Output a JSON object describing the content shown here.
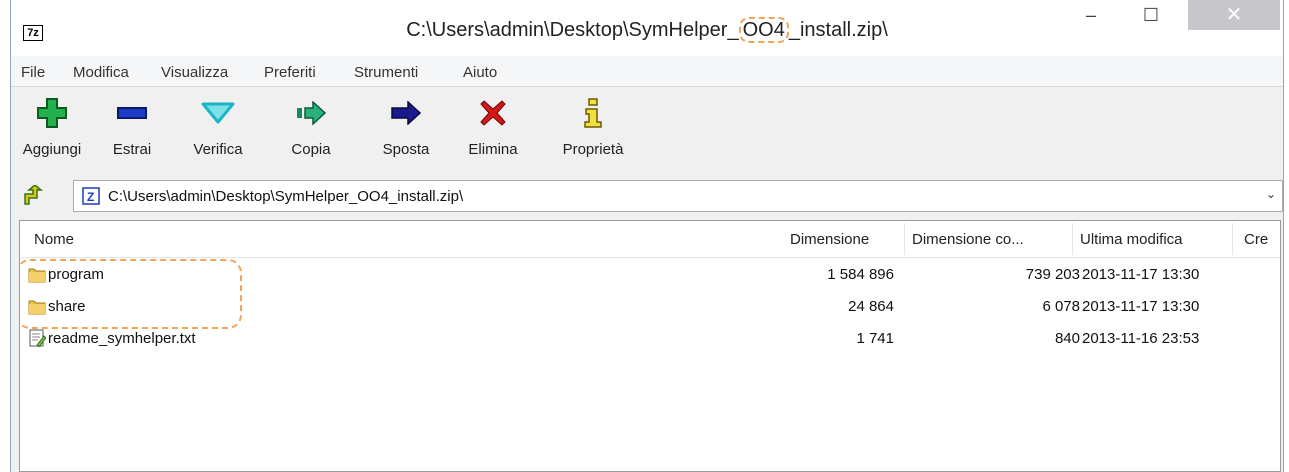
{
  "window": {
    "app_icon_text": "7z",
    "title_prefix": "C:\\Users\\admin\\Desktop\\SymHelper_",
    "title_highlight": "OO4",
    "title_suffix": "_install.zip\\",
    "min_glyph": "‒",
    "max_glyph": "☐",
    "close_glyph": "✕"
  },
  "menu": [
    "File",
    "Modifica",
    "Visualizza",
    "Preferiti",
    "Strumenti",
    "Aiuto"
  ],
  "toolbar": {
    "add": "Aggiungi",
    "extract": "Estrai",
    "test": "Verifica",
    "copy": "Copia",
    "move": "Sposta",
    "delete": "Elimina",
    "info": "Proprietà"
  },
  "address": {
    "path": "C:\\Users\\admin\\Desktop\\SymHelper_OO4_install.zip\\"
  },
  "columns": {
    "name": "Nome",
    "size": "Dimensione",
    "packed": "Dimensione co...",
    "modified": "Ultima modifica",
    "created": "Cre"
  },
  "rows": [
    {
      "name": "program",
      "size": "1 584 896",
      "packed": "739 203",
      "modified": "2013-11-17 13:30",
      "type": "folder"
    },
    {
      "name": "share",
      "size": "24 864",
      "packed": "6 078",
      "modified": "2013-11-17 13:30",
      "type": "folder"
    },
    {
      "name": "readme_symhelper.txt",
      "size": "1 741",
      "packed": "840",
      "modified": "2013-11-16 23:53",
      "type": "text-file"
    }
  ],
  "colors": {
    "highlight": "#f4a45a",
    "add_green": "#22b14c",
    "extract_blue": "#1c3cc8",
    "test_cyan": "#19b6c8",
    "move_navy": "#1a1a8c",
    "delete_red": "#d01818",
    "info_olive": "#8a7a00"
  }
}
